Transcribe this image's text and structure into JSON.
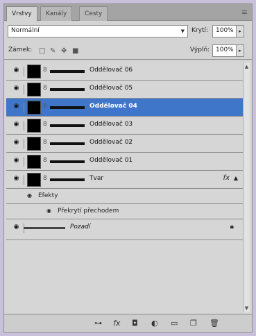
{
  "tabs": [
    {
      "label": "Vrstvy",
      "active": true
    },
    {
      "label": "Kanály",
      "active": false
    },
    {
      "label": "Cesty",
      "active": false
    }
  ],
  "panel_menu": "≡",
  "blend_mode": {
    "value": "Normální"
  },
  "opacity": {
    "label": "Krytí:",
    "value": "100%"
  },
  "fill": {
    "label": "Výplň:",
    "value": "100%"
  },
  "lock": {
    "label": "Zámek:"
  },
  "layers": [
    {
      "name": "Oddělovač 06",
      "selected": false
    },
    {
      "name": "Oddělovač 05",
      "selected": false
    },
    {
      "name": "Oddělovač 04",
      "selected": true
    },
    {
      "name": "Oddělovač 03",
      "selected": false
    },
    {
      "name": "Oddělovač 02",
      "selected": false
    },
    {
      "name": "Oddělovač 01",
      "selected": false
    },
    {
      "name": "Tvar",
      "selected": false,
      "fx": "fx"
    }
  ],
  "effects": {
    "label": "Efekty",
    "items": [
      "Překrytí přechodem"
    ]
  },
  "background_layer": {
    "name": "Pozadí"
  },
  "bottom_buttons": [
    "link",
    "fx",
    "mask",
    "adjustment",
    "group",
    "new-layer",
    "delete"
  ]
}
